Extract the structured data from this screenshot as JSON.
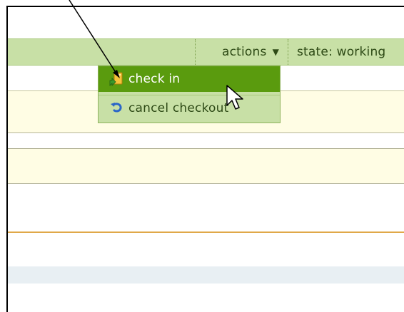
{
  "toolbar": {
    "actions_label": "actions",
    "actions_caret": "▼",
    "state_text": "state: working"
  },
  "menu": {
    "items": [
      {
        "label": "check in",
        "icon": "check-in-icon",
        "highlighted": true
      },
      {
        "label": "cancel checkout",
        "icon": "undo-icon",
        "highlighted": false
      }
    ]
  },
  "colors": {
    "toolbar_bg": "#c8e0a6",
    "highlight_bg": "#5a9b0e",
    "row_bg": "#fffde4",
    "orange_divider": "#e0a848"
  }
}
